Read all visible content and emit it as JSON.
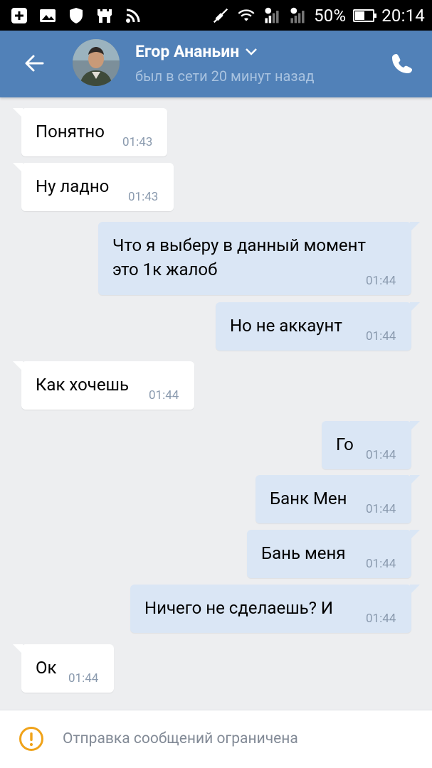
{
  "status_bar": {
    "battery": "50%",
    "time": "20:14",
    "battery_level": 0.5
  },
  "header": {
    "name": "Егор Ананьин",
    "status": "был в сети 20 минут назад",
    "icons": {
      "back": "arrow-left-icon",
      "dropdown": "chevron-down-icon",
      "call": "phone-icon"
    },
    "accent_color": "#5181b8"
  },
  "messages": [
    {
      "direction": "in",
      "text": "Понятно",
      "time": "01:43"
    },
    {
      "direction": "in",
      "text": "Ну ладно",
      "time": "01:43"
    },
    {
      "direction": "out",
      "text": "Что я выберу в данный момент\nэто 1к жалоб",
      "time": "01:44"
    },
    {
      "direction": "out",
      "text": "Но не аккаунт",
      "time": "01:44"
    },
    {
      "direction": "in",
      "text": "Как хочешь",
      "time": "01:44"
    },
    {
      "direction": "out",
      "text": "Го",
      "time": "01:44"
    },
    {
      "direction": "out",
      "text": "Банк Мен",
      "time": "01:44"
    },
    {
      "direction": "out",
      "text": "Бань меня",
      "time": "01:44"
    },
    {
      "direction": "out",
      "text": "Ничего не сделаешь? И",
      "time": "01:44"
    },
    {
      "direction": "in",
      "text": "Ок",
      "time": "01:44"
    }
  ],
  "bottom": {
    "notice": "Отправка сообщений ограничена",
    "icon": "warning-icon",
    "warning_color": "#f0a31a"
  }
}
